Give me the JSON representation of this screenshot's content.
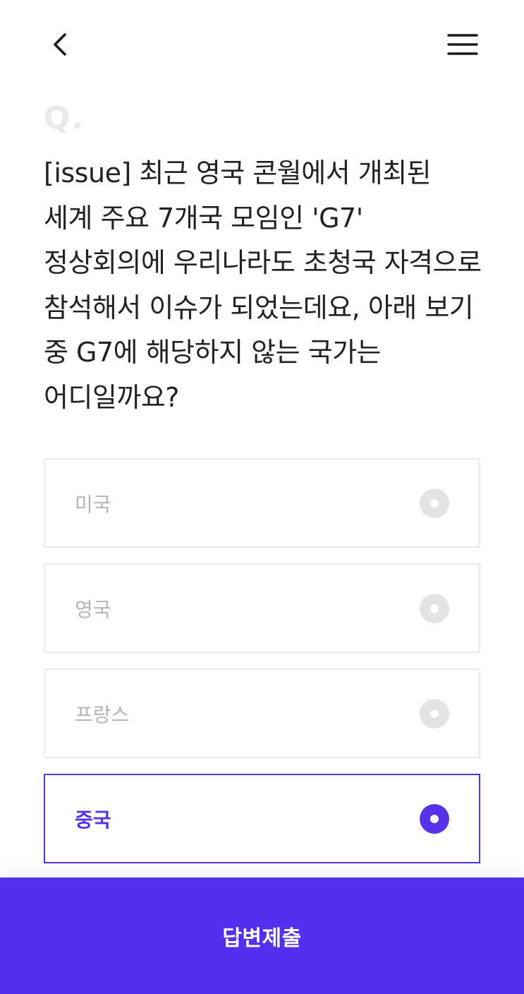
{
  "header": {
    "back_icon": "chevron-left-icon",
    "menu_icon": "hamburger-menu-icon"
  },
  "question": {
    "prefix": "Q.",
    "text": "[issue] 최근 영국 콘월에서 개최된 세계 주요 7개국 모임인 'G7' 정상회의에 우리나라도 초청국 자격으로 참석해서 이슈가 되었는데요, 아래 보기 중 G7에 해당하지 않는 국가는 어디일까요?"
  },
  "options": [
    {
      "label": "미국",
      "selected": false
    },
    {
      "label": "영국",
      "selected": false
    },
    {
      "label": "프랑스",
      "selected": false
    },
    {
      "label": "중국",
      "selected": true
    }
  ],
  "submit": {
    "label": "답변제출"
  },
  "colors": {
    "accent": "#5330ee",
    "selected_border": "#5732e8",
    "unselected_radio": "#e3e3e3",
    "unselected_text": "#b4b4b4"
  }
}
